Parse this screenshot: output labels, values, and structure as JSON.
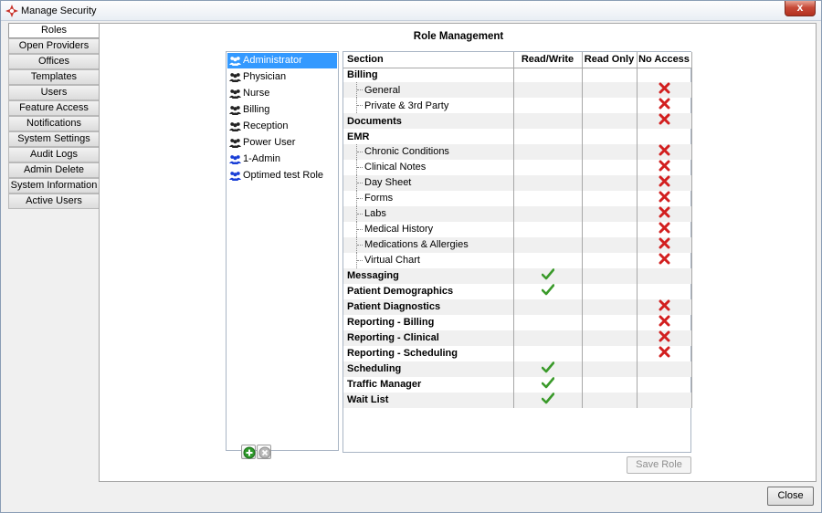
{
  "window": {
    "title": "Manage Security",
    "close_glyph": "x",
    "icon": "shield-star-icon"
  },
  "nav": {
    "items": [
      "Roles",
      "Open Providers",
      "Offices",
      "Templates",
      "Users",
      "Feature Access",
      "Notifications",
      "System Settings",
      "Audit Logs",
      "Admin Delete",
      "System Information",
      "Active Users"
    ],
    "active": "Roles"
  },
  "main": {
    "title": "Role Management"
  },
  "roles": {
    "items": [
      {
        "label": "Administrator",
        "icon": "group-icon",
        "selected": true
      },
      {
        "label": "Physician",
        "icon": "group-icon"
      },
      {
        "label": "Nurse",
        "icon": "group-icon"
      },
      {
        "label": "Billing",
        "icon": "group-icon"
      },
      {
        "label": "Reception",
        "icon": "group-icon"
      },
      {
        "label": "Power User",
        "icon": "group-icon"
      },
      {
        "label": "1-Admin",
        "icon": "custom-group-icon"
      },
      {
        "label": "Optimed test Role",
        "icon": "custom-group-icon"
      }
    ],
    "add_icon": "add-icon",
    "remove_icon": "remove-icon"
  },
  "grid": {
    "columns": [
      "Section",
      "Read/Write",
      "Read Only",
      "No Access"
    ],
    "rows": [
      {
        "label": "Billing",
        "group": true,
        "access": ""
      },
      {
        "label": "General",
        "group": false,
        "access": "none"
      },
      {
        "label": "Private & 3rd Party",
        "group": false,
        "access": "none"
      },
      {
        "label": "Documents",
        "group": true,
        "access": "none"
      },
      {
        "label": "EMR",
        "group": true,
        "access": ""
      },
      {
        "label": "Chronic Conditions",
        "group": false,
        "access": "none"
      },
      {
        "label": "Clinical Notes",
        "group": false,
        "access": "none"
      },
      {
        "label": "Day Sheet",
        "group": false,
        "access": "none"
      },
      {
        "label": "Forms",
        "group": false,
        "access": "none"
      },
      {
        "label": "Labs",
        "group": false,
        "access": "none"
      },
      {
        "label": "Medical History",
        "group": false,
        "access": "none"
      },
      {
        "label": "Medications & Allergies",
        "group": false,
        "access": "none"
      },
      {
        "label": "Virtual Chart",
        "group": false,
        "access": "none"
      },
      {
        "label": "Messaging",
        "group": true,
        "access": "rw"
      },
      {
        "label": "Patient Demographics",
        "group": true,
        "access": "rw"
      },
      {
        "label": "Patient Diagnostics",
        "group": true,
        "access": "none"
      },
      {
        "label": "Reporting - Billing",
        "group": true,
        "access": "none"
      },
      {
        "label": "Reporting - Clinical",
        "group": true,
        "access": "none"
      },
      {
        "label": "Reporting - Scheduling",
        "group": true,
        "access": "none"
      },
      {
        "label": "Scheduling",
        "group": true,
        "access": "rw"
      },
      {
        "label": "Traffic Manager",
        "group": true,
        "access": "rw"
      },
      {
        "label": "Wait List",
        "group": true,
        "access": "rw"
      }
    ],
    "mark_icons": {
      "rw": "check-icon",
      "none": "x-icon"
    }
  },
  "buttons": {
    "save_role": "Save Role",
    "close": "Close"
  },
  "colors": {
    "selection": "#3399ff",
    "check": "#3a9a2a",
    "cross": "#d21f1f",
    "role_icon": "#222222",
    "custom_role_icon": "#1a3fd6"
  }
}
